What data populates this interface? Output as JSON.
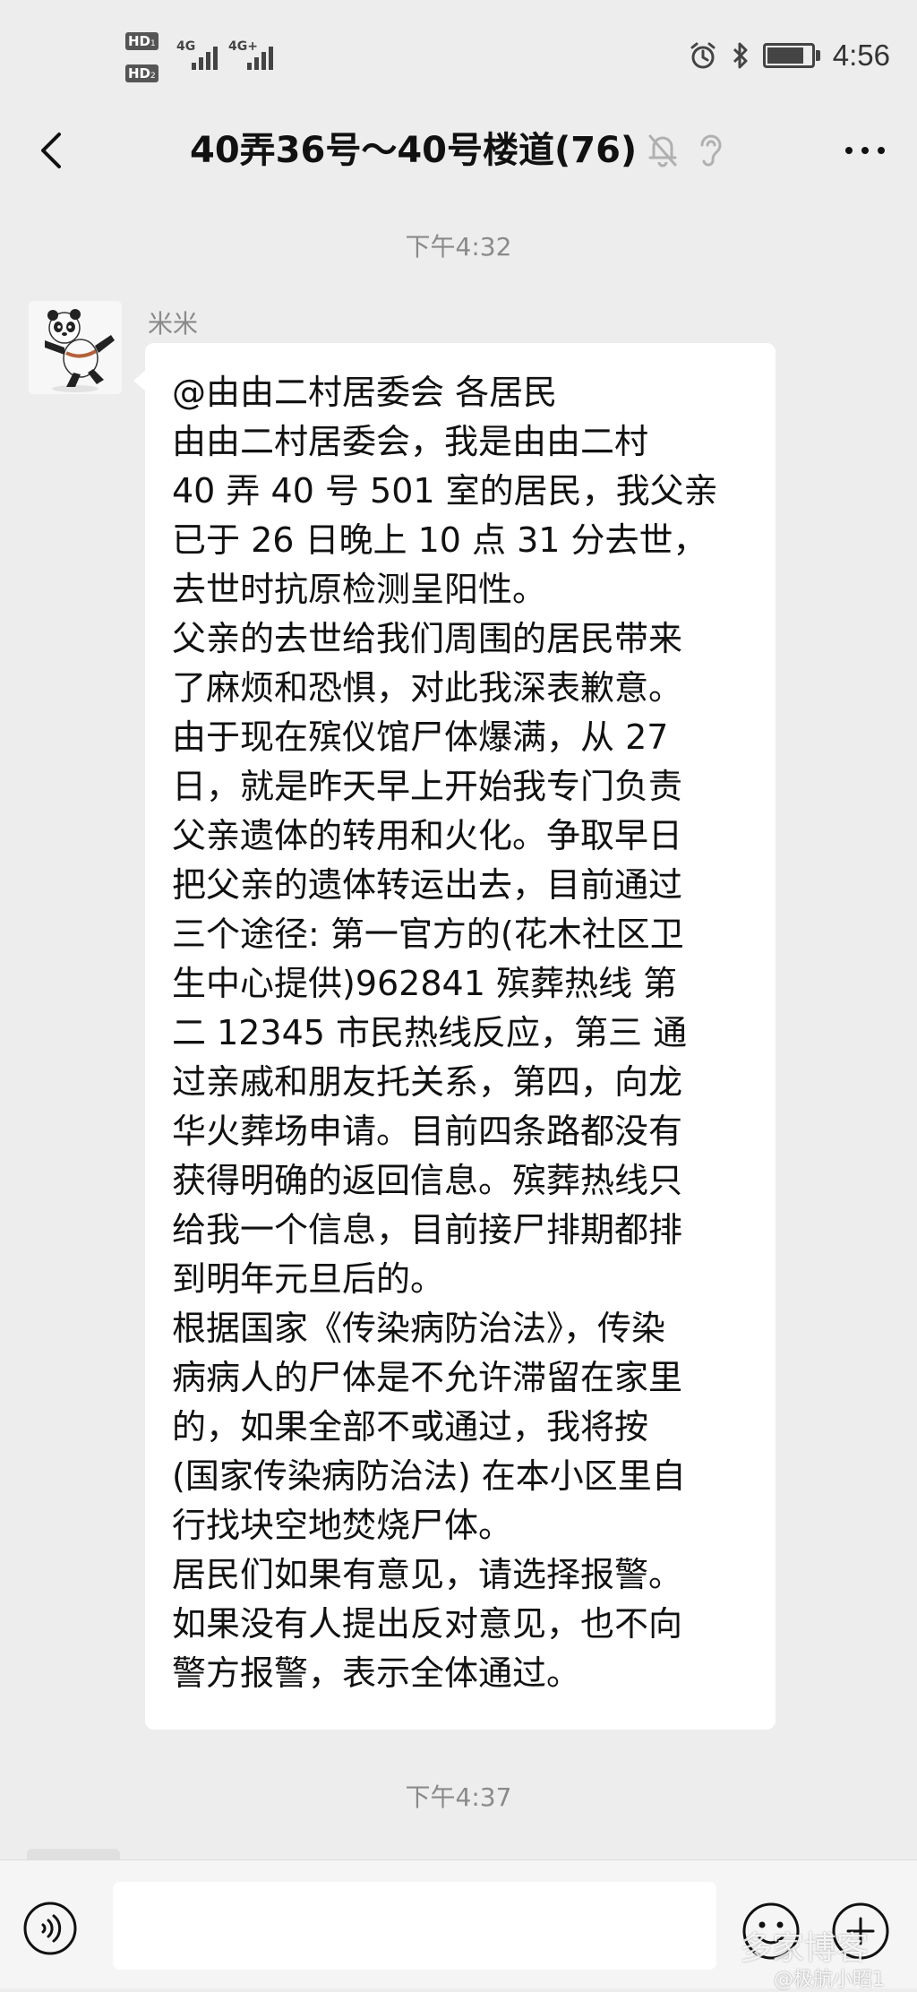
{
  "status_bar": {
    "sim1_badge": "HD",
    "sim1_index": "1",
    "sim2_badge": "HD",
    "sim2_index": "2",
    "sim1_network": "4G",
    "sim2_network": "4G+",
    "battery_level": 0.9,
    "time": "4:56",
    "icons": [
      "alarm-icon",
      "bluetooth-icon",
      "battery-icon"
    ]
  },
  "header": {
    "title": "40弄36号～40号楼道(76)",
    "icons": [
      "back-arrow-icon",
      "mute-bell-icon",
      "ear-icon",
      "more-dots-icon"
    ]
  },
  "chat": {
    "timestamp_1": "下午4:32",
    "sender_name": "米米",
    "avatar_icon": "panda-avatar-icon",
    "message_lines": [
      "@由由二村居委会  各居民",
      "由由二村居委会，我是由由二村",
      "40 弄 40 号 501 室的居民，我父亲",
      "已于 26 日晚上 10 点 31 分去世，",
      "去世时抗原检测呈阳性。",
      "父亲的去世给我们周围的居民带来",
      "了麻烦和恐惧，对此我深表歉意。",
      "由于现在殡仪馆尸体爆满，从 27",
      "日，就是昨天早上开始我专门负责",
      "父亲遗体的转用和火化。争取早日",
      "把父亲的遗体转运出去，目前通过",
      "三个途径: 第一官方的(花木社区卫",
      "生中心提供)962841 殡葬热线 第",
      "二 12345 市民热线反应，第三 通",
      "过亲戚和朋友托关系，第四，向龙",
      "华火葬场申请。目前四条路都没有",
      "获得明确的返回信息。殡葬热线只",
      "给我一个信息，目前接尸排期都排",
      "到明年元旦后的。",
      "根据国家《传染病防治法》，传染",
      "病病人的尸体是不允许滞留在家里",
      "的，如果全部不或通过，我将按",
      "(国家传染病防治法) 在本小区里自",
      "行找块空地焚烧尸体。",
      "居民们如果有意见，请选择报警。",
      "如果没有人提出反对意见，也不向",
      "警方报警，表示全体通过。"
    ],
    "timestamp_2": "下午4:37"
  },
  "input_bar": {
    "text_value": "",
    "icons": [
      "voice-icon",
      "emoji-icon",
      "plus-icon"
    ]
  },
  "watermark": {
    "line1": "多家博客",
    "line2": "@极航小昭1"
  },
  "colors": {
    "chat_background": "#ededed",
    "bubble_background": "#ffffff",
    "timestamp_text": "#8a8a8a",
    "input_bar_background": "#f5f5f5"
  }
}
